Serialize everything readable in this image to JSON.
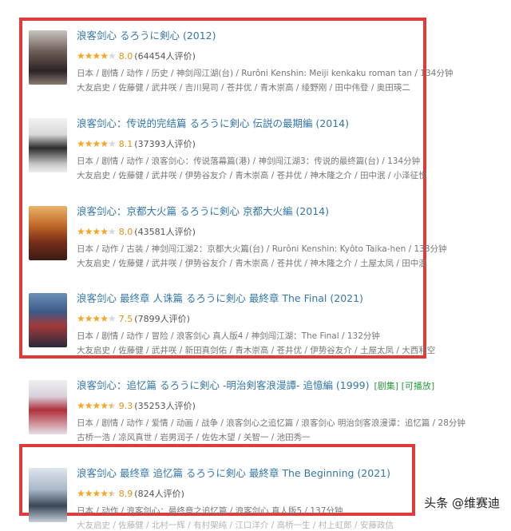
{
  "watermark": "头条 @维赛迪",
  "colors": {
    "frame": "#e03b3b",
    "title": "#3377aa",
    "star": "#f5a623",
    "playable": "#2a9a3a"
  },
  "items": [
    {
      "title": "浪客剑心 るろうに剣心 (2012)",
      "stars": 4,
      "score": "8.0",
      "count": "(64454人评价)",
      "meta1": "日本 / 剧情 / 动作 / 历史 / 神剑闯江湖(台) / Rurôni Kenshin: Meiji kenkaku roman tan / 134分钟",
      "meta2": "大友启史 / 佐藤健 / 武井咲 / 吉川晃司 / 苍井优 / 青木崇高 / 绫野刚 / 田中伟登 / 奥田瑛二"
    },
    {
      "title": "浪客剑心：传说的完结篇 るろうに剣心 伝説の最期編 (2014)",
      "stars": 4,
      "score": "8.1",
      "count": "(37393人评价)",
      "meta1": "日本 / 剧情 / 动作 / 浪客剑心：传说落幕篇(港) / 神剑闯江湖3：传说的最终篇(台) / 134分钟",
      "meta2": "大友启史 / 佐藤健 / 武井咲 / 伊势谷友介 / 青木崇高 / 苍井优 / 神木隆之介 / 田中泯 / 小泽征悦"
    },
    {
      "title": "浪客剑心：京都大火篇 るろうに剣心 京都大火編 (2014)",
      "stars": 4,
      "score": "8.0",
      "count": "(43581人评价)",
      "meta1": "日本 / 动作 / 古装 / 神剑闯江湖2：京都大火篇(台) / Rurôni Kenshin: Kyôto Taika-hen / 138分钟",
      "meta2": "大友启史 / 佐藤健 / 武井咲 / 伊势谷友介 / 青木崇高 / 苍井优 / 神木隆之介 / 土屋太凤 / 田中泯"
    },
    {
      "title": "浪客剑心 最终章 人诛篇 るろうに剣心 最終章 The Final (2021)",
      "stars": 4,
      "score": "7.5",
      "count": "(7899人评价)",
      "meta1": "日本 / 剧情 / 动作 / 冒险 / 浪客剑心 真人版4 / 神剑闯江湖：The Final / 132分钟",
      "meta2": "大友启史 / 佐藤健 / 武井咲 / 新田真剑佑 / 青木崇高 / 苍井优 / 伊势谷友介 / 土屋太凤 / 大西利空"
    },
    {
      "title": "浪客剑心：追忆篇 るろうに剣心 -明治剣客浪漫譚- 追憶編 (1999)",
      "tag": "[剧集] [可播放]",
      "stars": 4.5,
      "score": "9.3",
      "count": "(35253人评价)",
      "meta1": "日本 / 剧情 / 动作 / 爱情 / 动画 / 战争 / 浪客剑心之追忆篇 / 浪客剑心 明治剑客浪漫谭：追忆篇 / 28分钟",
      "meta2": "古桥一浩 / 凉风真世 / 岩男润子 / 佐佐木望 / 关智一 / 池田秀一"
    },
    {
      "title": "浪客剑心 最终章 追忆篇 るろうに剣心 最終章 The Beginning (2021)",
      "stars": 4.5,
      "score": "8.9",
      "count": "(824人评价)",
      "meta1": "日本 / 动作 / 浪客剑心：最终章之追忆篇 / 浪客剑心 真人版5 / 137分钟",
      "meta2": "大友启史 / 佐藤健 / 北村一辉 / 有村架纯 / 江口洋介 / 高桥一生 / 村上虹郎 / 安藤政信"
    }
  ]
}
